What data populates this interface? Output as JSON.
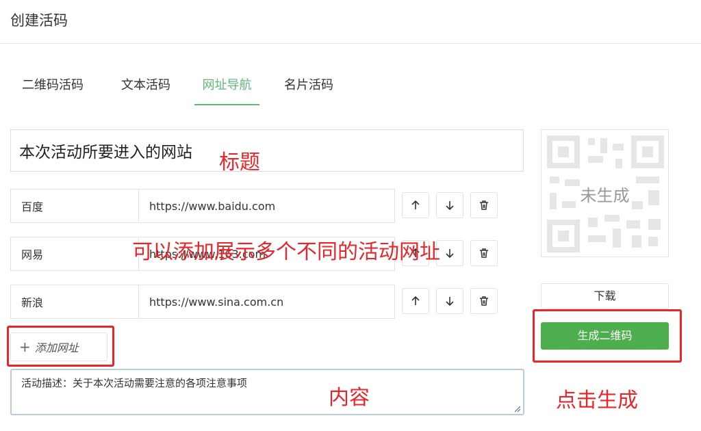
{
  "header": {
    "title": "创建活码"
  },
  "tabs": [
    {
      "label": "二维码活码",
      "active": false
    },
    {
      "label": "文本活码",
      "active": false
    },
    {
      "label": "网址导航",
      "active": true
    },
    {
      "label": "名片活码",
      "active": false
    }
  ],
  "form": {
    "title_value": "本次活动所要进入的网站",
    "links": [
      {
        "name": "百度",
        "url": "https://www.baidu.com"
      },
      {
        "name": "网易",
        "url": "https://www.163.com"
      },
      {
        "name": "新浪",
        "url": "https://www.sina.com.cn"
      }
    ],
    "add_label": "添加网址",
    "description": "活动描述：关于本次活动需要注意的各项注意事项"
  },
  "preview": {
    "qr_status": "未生成",
    "download_label": "下载",
    "generate_label": "生成二维码"
  },
  "annotations": {
    "title": "标题",
    "multi": "可以添加展示多个不同的活动网址",
    "content": "内容",
    "click": "点击生成"
  },
  "icons": {
    "up": "arrow-up-icon",
    "down": "arrow-down-icon",
    "delete": "trash-icon",
    "add": "plus-icon"
  },
  "colors": {
    "accent": "#5fb878",
    "primary_button": "#4cae4c",
    "annotation": "#e8262a"
  }
}
